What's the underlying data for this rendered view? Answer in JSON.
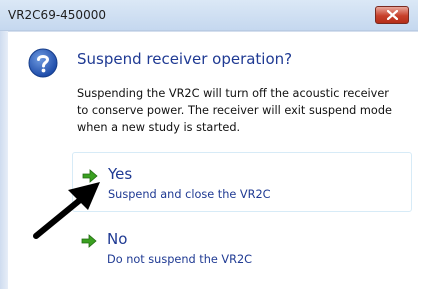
{
  "window": {
    "title": "VR2C69-450000"
  },
  "dialog": {
    "heading": "Suspend receiver operation?",
    "description_lines": [
      "Suspending the VR2C will turn off the acoustic receiver",
      "to conserve power. The receiver will exit suspend mode",
      "when a new study is started."
    ],
    "options": [
      {
        "label": "Yes",
        "sublabel": "Suspend and close the VR2C"
      },
      {
        "label": "No",
        "sublabel": "Do not suspend the VR2C"
      }
    ]
  },
  "icons": {
    "title_close": "close-icon",
    "question": "question-icon",
    "option_arrow": "green-arrow-icon",
    "annotation": "black-pointer-arrow"
  },
  "colors": {
    "heading": "#1f3a93",
    "option_arrow": "#3aa020",
    "close_button": "#c7402b"
  }
}
